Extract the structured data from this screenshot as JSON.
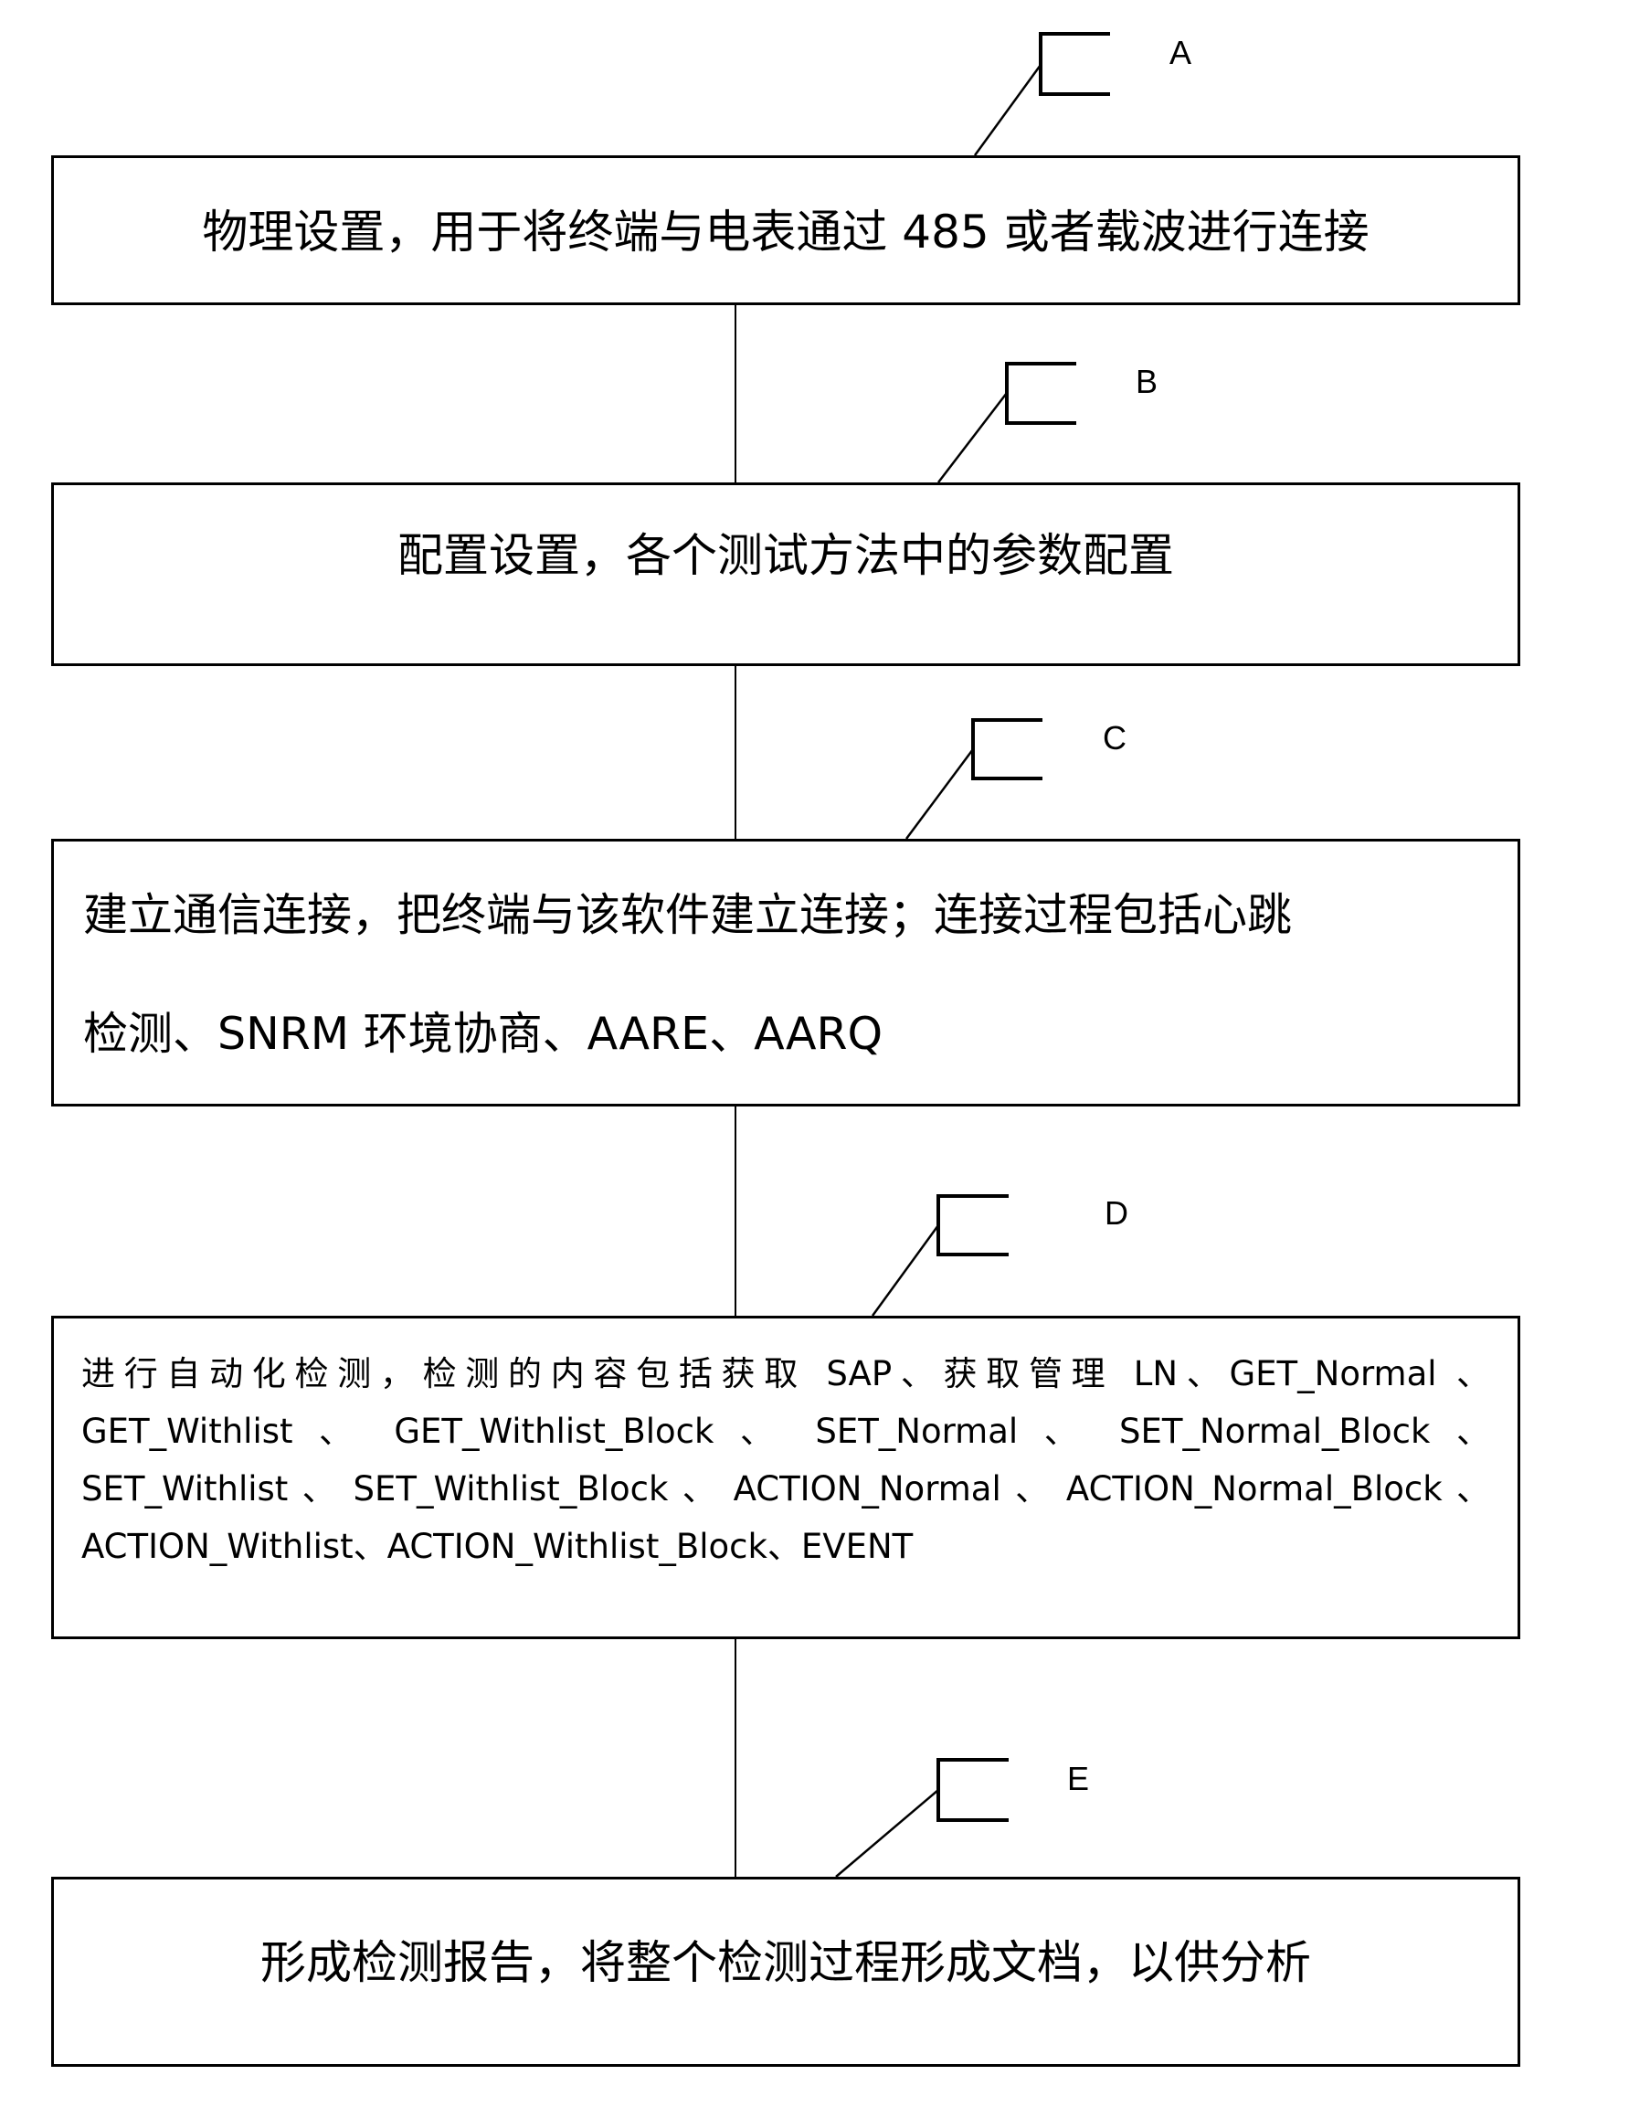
{
  "diagram": {
    "type": "flowchart",
    "steps": [
      {
        "label": "A",
        "text": "物理设置，用于将终端与电表通过 485 或者载波进行连接"
      },
      {
        "label": "B",
        "text": "配置设置，各个测试方法中的参数配置"
      },
      {
        "label": "C",
        "lines": [
          "建立通信连接，把终端与该软件建立连接；连接过程包括心跳",
          "检测、SNRM 环境协商、AARE、AARQ"
        ]
      },
      {
        "label": "D",
        "lines": [
          "进行自动化检测，检测的内容包括获取 SAP、获取管理 LN、GET_Normal 、",
          "GET_Withlist 、 GET_Withlist_Block 、 SET_Normal 、 SET_Normal_Block 、",
          "SET_Withlist 、 SET_Withlist_Block 、 ACTION_Normal 、 ACTION_Normal_Block 、",
          "ACTION_Withlist、ACTION_Withlist_Block、EVENT"
        ]
      },
      {
        "label": "E",
        "text": "形成检测报告，将整个检测过程形成文档，以供分析"
      }
    ]
  }
}
